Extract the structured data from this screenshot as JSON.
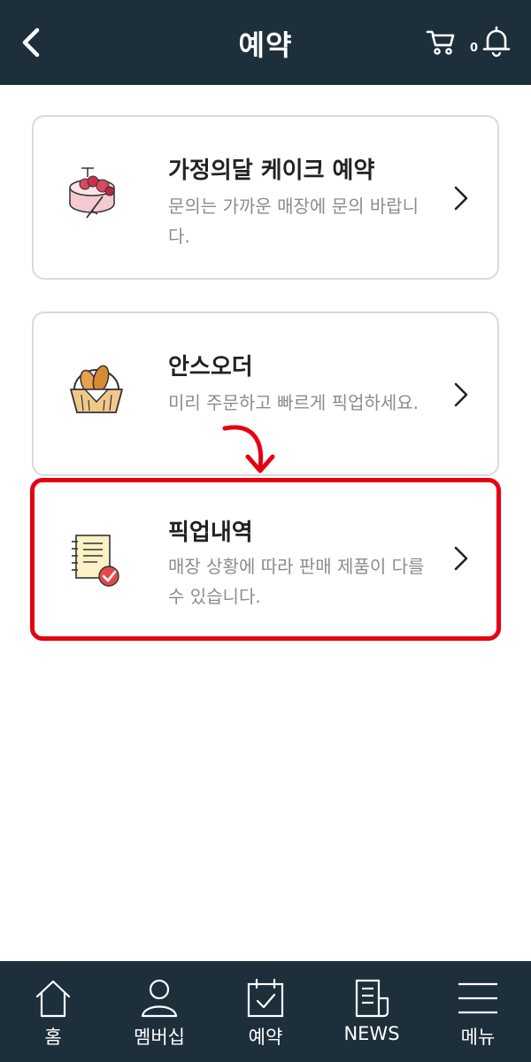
{
  "header": {
    "title": "예약",
    "cart_count": "0",
    "back_icon": "chevron-left-icon",
    "cart_icon": "cart-icon",
    "bell_icon": "bell-icon"
  },
  "cards": [
    {
      "title": "가정의달 케이크 예약",
      "description": "문의는 가까운 매장에 문의 바랍니다.",
      "icon": "cake-icon"
    },
    {
      "title": "안스오더",
      "description": "미리 주문하고 빠르게 픽업하세요.",
      "icon": "bread-basket-icon"
    },
    {
      "title": "픽업내역",
      "description": "매장 상황에 따라 판매 제품이 다를 수 있습니다.",
      "icon": "notepad-check-icon"
    }
  ],
  "tabbar": {
    "items": [
      {
        "label": "홈",
        "icon": "home-icon"
      },
      {
        "label": "멤버십",
        "icon": "user-icon"
      },
      {
        "label": "예약",
        "icon": "calendar-check-icon"
      },
      {
        "label": "NEWS",
        "icon": "news-icon"
      },
      {
        "label": "메뉴",
        "icon": "menu-icon"
      }
    ]
  },
  "colors": {
    "header_bg": "#1c2f3b",
    "highlight": "#e60012",
    "description_text": "#8c8c8c"
  }
}
